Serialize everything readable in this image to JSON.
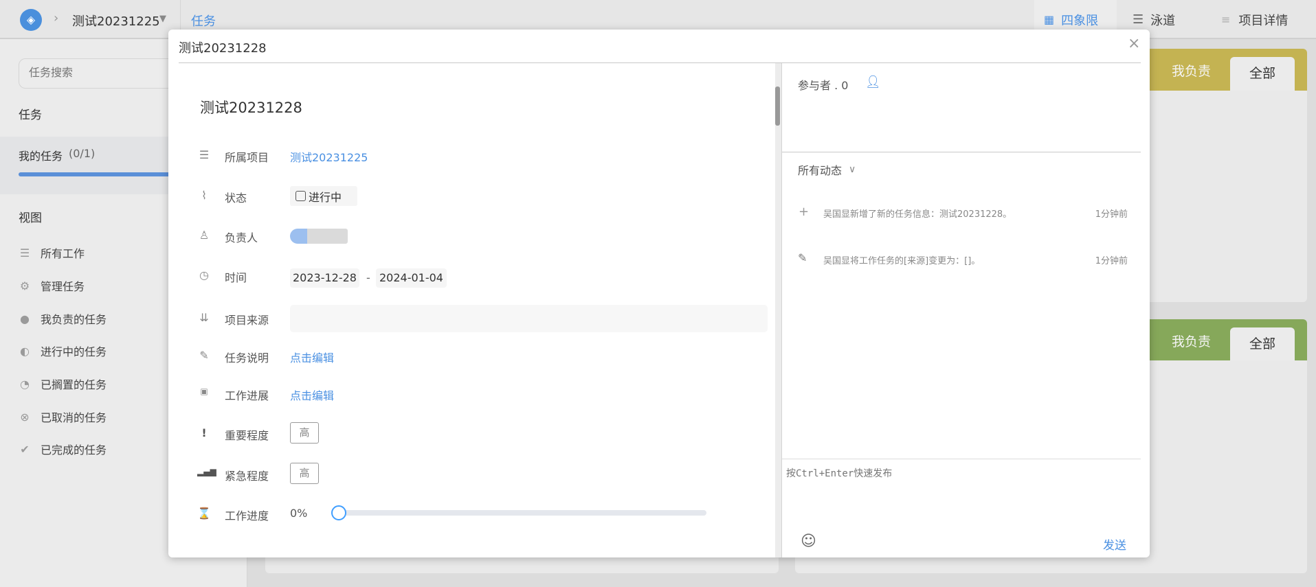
{
  "topbar": {
    "project_name": "测试20231225",
    "tab_task": "任务",
    "views": [
      {
        "label": "四象限",
        "icon": "grid-icon"
      },
      {
        "label": "泳道",
        "icon": "lanes-icon"
      },
      {
        "label": "项目详情",
        "icon": "details-icon"
      }
    ]
  },
  "sidebar": {
    "search_placeholder": "任务搜索",
    "section_task": "任务",
    "my_tasks": "我的任务",
    "my_tasks_count": "(0/1)",
    "my_tasks_progress": 1,
    "section_view": "视图",
    "items": [
      {
        "label": "所有工作",
        "icon": "list-icon"
      },
      {
        "label": "管理任务",
        "icon": "gear-icon"
      },
      {
        "label": "我负责的任务",
        "icon": "user-icon"
      },
      {
        "label": "进行中的任务",
        "icon": "half-circle-icon"
      },
      {
        "label": "已搁置的任务",
        "icon": "clock-icon"
      },
      {
        "label": "已取消的任务",
        "icon": "cancel-icon"
      },
      {
        "label": "已完成的任务",
        "icon": "check-icon"
      }
    ]
  },
  "board": {
    "cards": [
      {
        "tab_mine": "我负责",
        "tab_all": "全部",
        "color": "#c4b352"
      },
      {
        "tab_mine": "我负责",
        "tab_all": "全部",
        "color": "#86a85a"
      }
    ]
  },
  "dialog": {
    "header_title": "测试20231228",
    "close": "×",
    "task_title": "测试20231228",
    "fields": {
      "project_label": "所属项目",
      "project_value": "测试20231225",
      "status_label": "状态",
      "status_value": "进行中",
      "owner_label": "负责人",
      "time_label": "时间",
      "start_date": "2023-12-28",
      "date_sep": "-",
      "end_date": "2024-01-04",
      "source_label": "项目来源",
      "source_value": "",
      "desc_label": "任务说明",
      "desc_value": "点击编辑",
      "progress_note_label": "工作进展",
      "progress_note_value": "点击编辑",
      "importance_label": "重要程度",
      "importance_value": "高",
      "urgency_label": "紧急程度",
      "urgency_value": "高",
      "progress_label": "工作进度",
      "progress_value": "0%",
      "progress_fraction": 0
    },
    "participants_label": "参与者 . 0",
    "activity_filter": "所有动态",
    "activities": [
      {
        "icon": "plus-icon",
        "text": "吴国显新增了新的任务信息：测试20231228。",
        "time": "1分钟前"
      },
      {
        "icon": "edit-icon",
        "text": "吴国显将工作任务的[来源]变更为：[]。",
        "time": "1分钟前"
      }
    ],
    "comment_placeholder": "按Ctrl+Enter快速发布",
    "send": "发送"
  }
}
